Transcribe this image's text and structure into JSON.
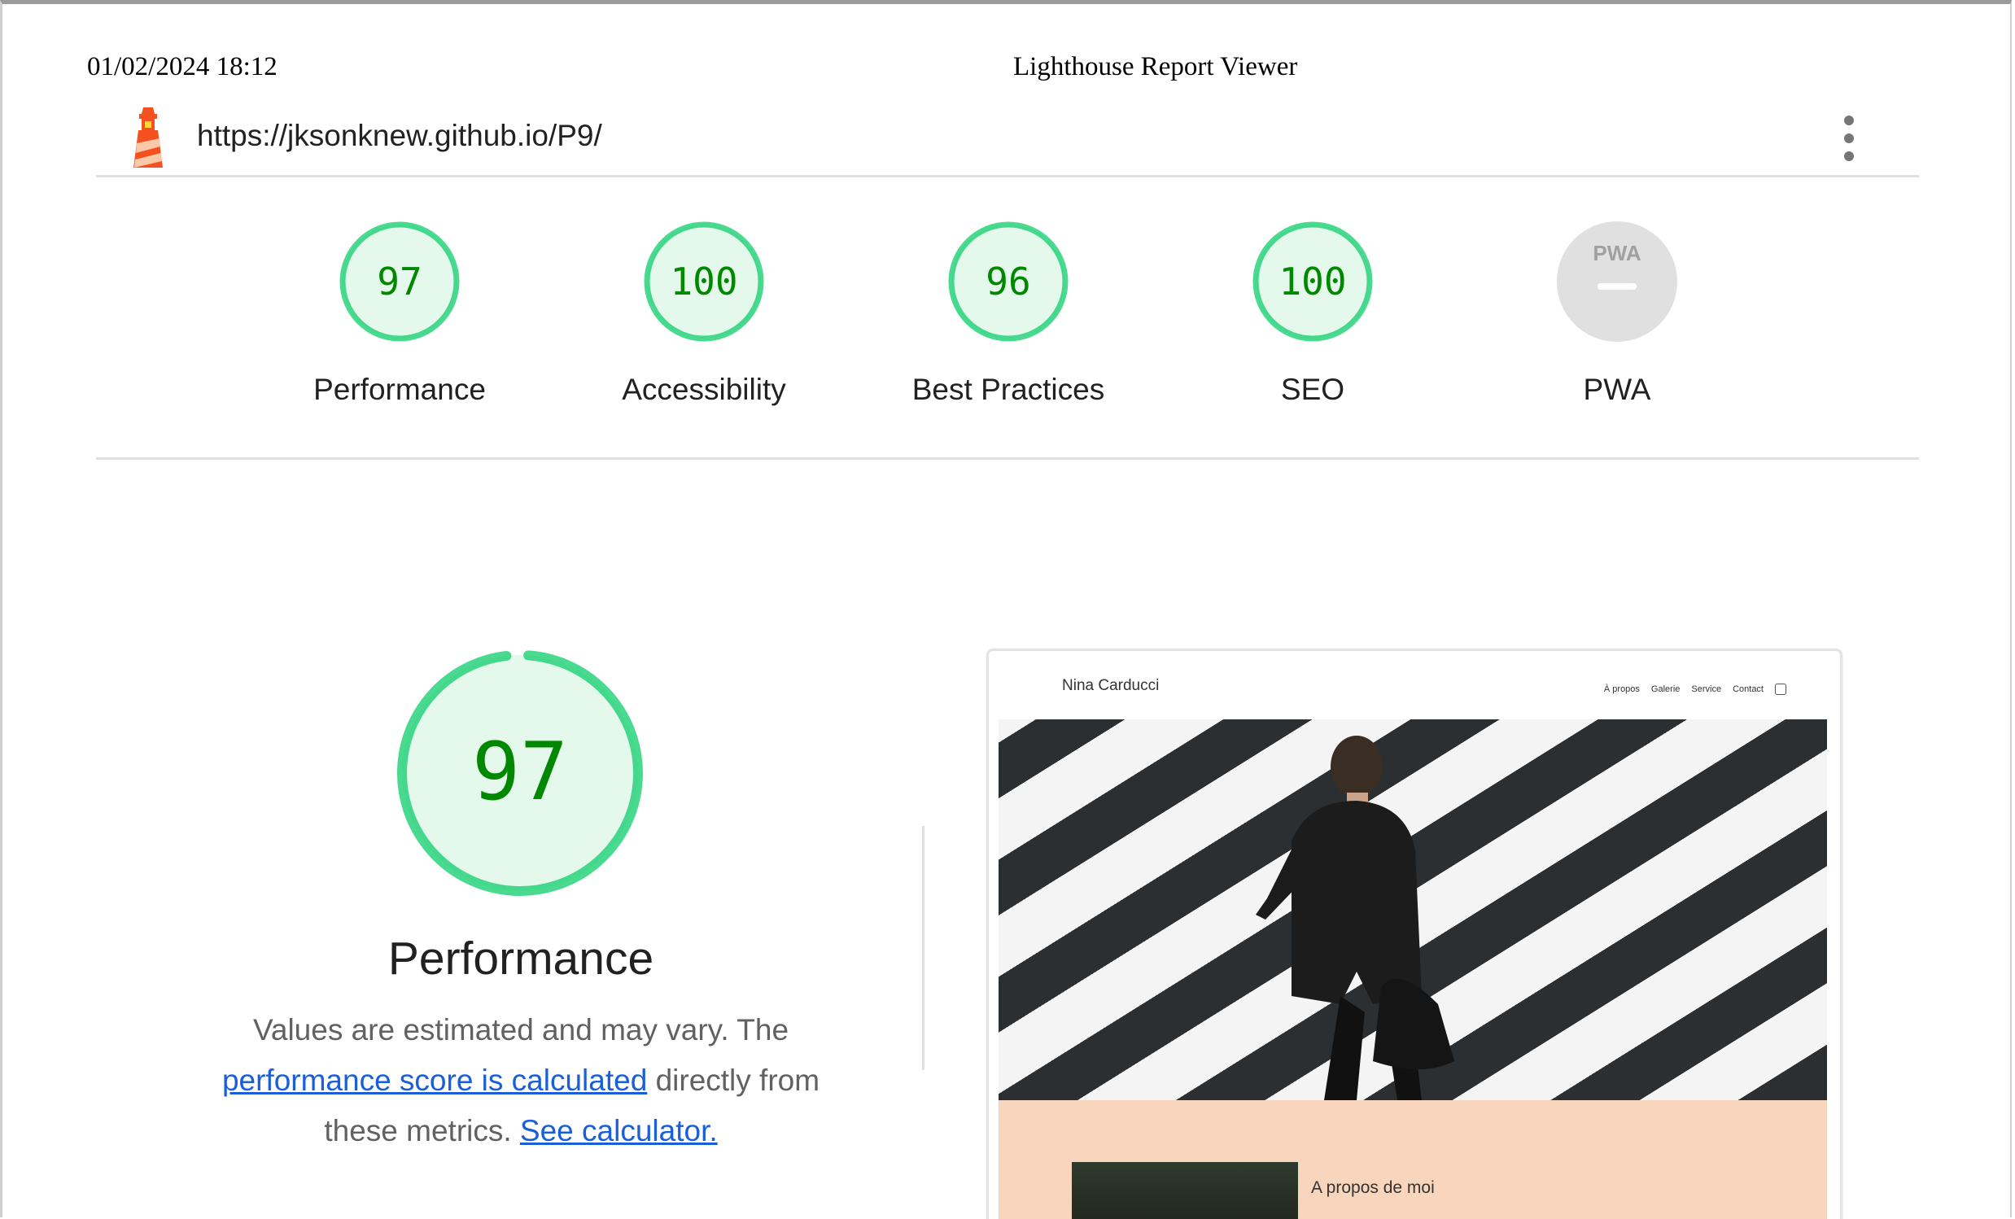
{
  "print_header": {
    "datetime": "01/02/2024 18:12",
    "title": "Lighthouse Report Viewer"
  },
  "topbar": {
    "url": "https://jksonknew.github.io/P9/",
    "menu_icon": "kebab-menu-icon"
  },
  "colors": {
    "pass": "#0cce6b",
    "pass_text": "#008800",
    "pass_fill": "#e5f8ec",
    "pwa_grey": "#e0e0e0",
    "link": "#1a5fd9"
  },
  "gauges": [
    {
      "label": "Performance",
      "score": "97"
    },
    {
      "label": "Accessibility",
      "score": "100"
    },
    {
      "label": "Best Practices",
      "score": "96"
    },
    {
      "label": "SEO",
      "score": "100"
    },
    {
      "label": "PWA",
      "badge": "PWA"
    }
  ],
  "performance": {
    "score": "97",
    "title": "Performance",
    "desc_1": "Values are estimated and may vary. The",
    "link_score": "performance score is calculated",
    "desc_2": "directly from these metrics.",
    "link_calc": "See calculator."
  },
  "screenshot": {
    "brand": "Nina Carducci",
    "nav": [
      "À propos",
      "Galerie",
      "Service",
      "Contact"
    ],
    "about_title": "A propos de moi"
  }
}
